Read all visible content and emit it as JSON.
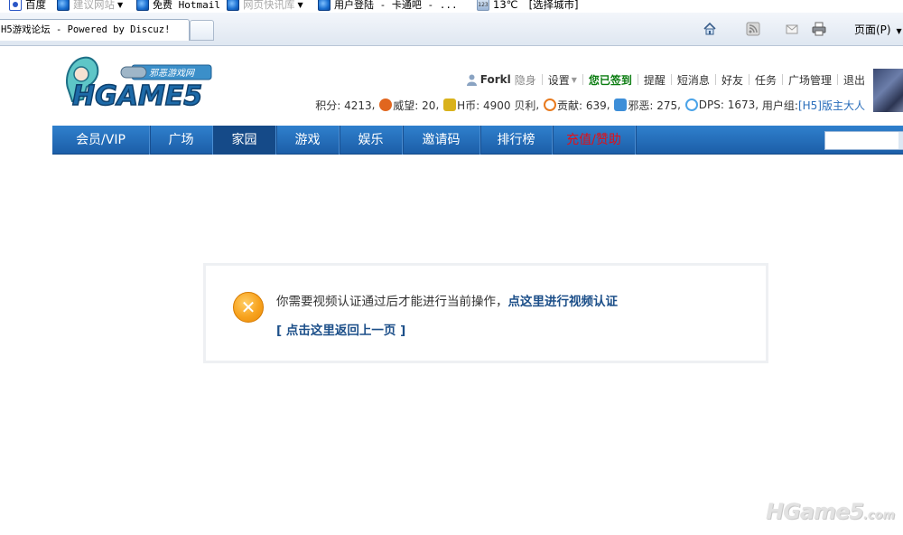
{
  "favorites": [
    {
      "label": "百度",
      "icon": "baidu-paw-icon",
      "dropdown": false
    },
    {
      "label": "建议网站",
      "icon": "ie-icon",
      "dropdown": true,
      "muted": true
    },
    {
      "label": "免费 Hotmail",
      "icon": "ie-icon",
      "dropdown": false
    },
    {
      "label": "网页快讯库",
      "icon": "ie-icon",
      "dropdown": true,
      "muted": true
    },
    {
      "label": "用户登陆 - 卡通吧 - ...",
      "icon": "ie-icon",
      "dropdown": false
    }
  ],
  "weather": {
    "temp": "13℃",
    "city_label": "[选择城市]"
  },
  "tab": {
    "title": "H5游戏论坛 - Powered by Discuz!"
  },
  "toolbar": {
    "page_menu_label": "页面(P)"
  },
  "site": {
    "logo_text": "HGAME5",
    "logo_banner": "邪恶游戏网"
  },
  "user": {
    "name": "Forkl",
    "invisible_label": "隐身",
    "links": [
      "设置",
      "您已签到",
      "提醒",
      "短消息",
      "好友",
      "任务",
      "广场管理",
      "退出"
    ]
  },
  "stats": {
    "credits_label": "积分: 4213",
    "prestige_label": "威望: 20",
    "hcoin_label": "H币: 4900 贝利",
    "contribution_label": "贡献: 639",
    "evil_label": "邪恶: 275",
    "dps_label": "DPS: 1673",
    "group_prefix": "用户组: ",
    "group_value": "[H5]版主大人"
  },
  "nav": {
    "items": [
      {
        "label": "会员/VIP",
        "width": 108
      },
      {
        "label": "广场",
        "width": 70
      },
      {
        "label": "家园",
        "width": 70,
        "active": true
      },
      {
        "label": "游戏",
        "width": 70
      },
      {
        "label": "娱乐",
        "width": 70
      },
      {
        "label": "邀请码",
        "width": 86
      },
      {
        "label": "排行榜",
        "width": 80
      },
      {
        "label": "充值/赞助",
        "width": 92,
        "red": true
      }
    ]
  },
  "alert": {
    "message": "你需要视频认证通过后才能进行当前操作，",
    "link_text": "点这里进行视频认证",
    "back_text": "[ 点击这里返回上一页 ]"
  },
  "watermark": {
    "text": "HGame5",
    "suffix": ".com"
  },
  "colors": {
    "nav_bg": "#1c5ea8",
    "nav_active": "#154a88",
    "link": "#1c4f89",
    "alert_icon": "#f7a21e",
    "sign_green": "#0a7c10",
    "donate_red": "#e50e14"
  }
}
